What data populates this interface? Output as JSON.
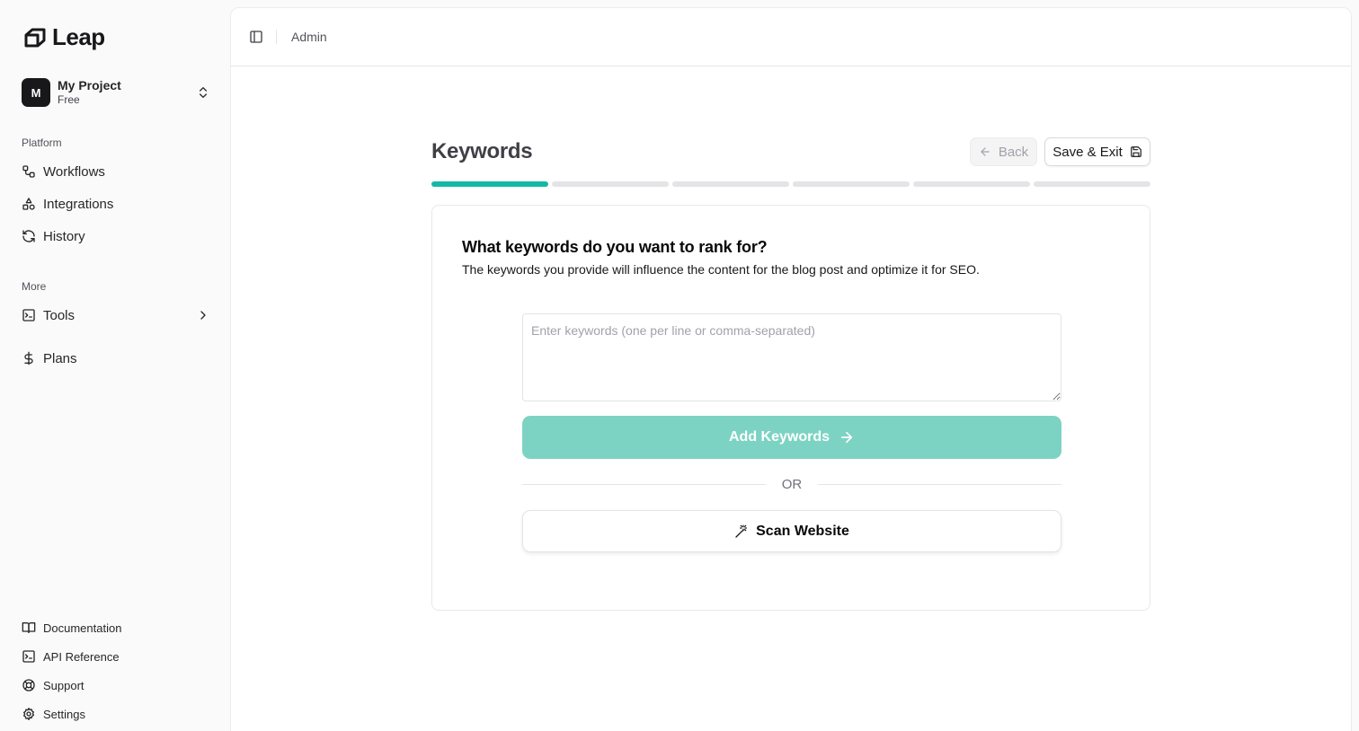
{
  "brand": {
    "name": "Leap",
    "accent": "#14b8a6",
    "accent_light": "#7dd3c3"
  },
  "project": {
    "initial": "M",
    "name": "My Project",
    "plan": "Free"
  },
  "sidebar": {
    "platform_label": "Platform",
    "platform_items": [
      {
        "label": "Workflows",
        "icon": "workflow-icon"
      },
      {
        "label": "Integrations",
        "icon": "shapes-icon"
      },
      {
        "label": "History",
        "icon": "refresh-icon"
      }
    ],
    "more_label": "More",
    "more_items": [
      {
        "label": "Tools",
        "icon": "terminal-icon"
      },
      {
        "label": "Plans",
        "icon": "dollar-icon"
      }
    ],
    "footer_items": [
      {
        "label": "Documentation",
        "icon": "book-icon"
      },
      {
        "label": "API Reference",
        "icon": "terminal-icon"
      },
      {
        "label": "Support",
        "icon": "lifebuoy-icon"
      },
      {
        "label": "Settings",
        "icon": "gear-icon"
      }
    ]
  },
  "topbar": {
    "breadcrumb": "Admin"
  },
  "wizard": {
    "title": "Keywords",
    "back_label": "Back",
    "save_label": "Save & Exit",
    "total_steps": 6,
    "current_step": 1,
    "question": "What keywords do you want to rank for?",
    "description": "The keywords you provide will influence the content for the blog post and optimize it for SEO.",
    "input_placeholder": "Enter keywords (one per line or comma-separated)",
    "input_value": "",
    "add_label": "Add Keywords",
    "or_label": "OR",
    "scan_label": "Scan Website"
  }
}
